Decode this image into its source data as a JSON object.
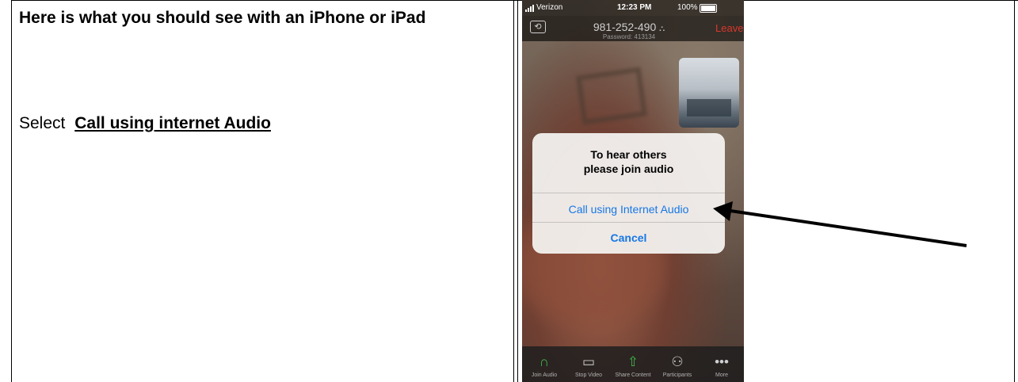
{
  "document": {
    "heading": "Here is what you should see with an iPhone or iPad",
    "instruction_prefix": "Select",
    "instruction_target": "Call using internet Audio"
  },
  "phone": {
    "status_bar": {
      "carrier": "Verizon",
      "time": "12:23 PM",
      "battery": "100%"
    },
    "meeting": {
      "id": "981-252-490",
      "password": "Password: 413134",
      "leave": "Leave"
    },
    "dialog": {
      "title_line1": "To hear others",
      "title_line2": "please join audio",
      "call_button": "Call using Internet Audio",
      "cancel_button": "Cancel"
    },
    "toolbar": [
      {
        "label": "Join Audio",
        "icon": "headphones-icon"
      },
      {
        "label": "Stop Video",
        "icon": "video-camera-icon"
      },
      {
        "label": "Share Content",
        "icon": "share-icon"
      },
      {
        "label": "Participants",
        "icon": "participants-icon"
      },
      {
        "label": "More",
        "icon": "more-icon"
      }
    ]
  },
  "colors": {
    "accent_blue": "#1677e6",
    "leave_red": "#d9372c",
    "active_green": "#3fb74b"
  }
}
